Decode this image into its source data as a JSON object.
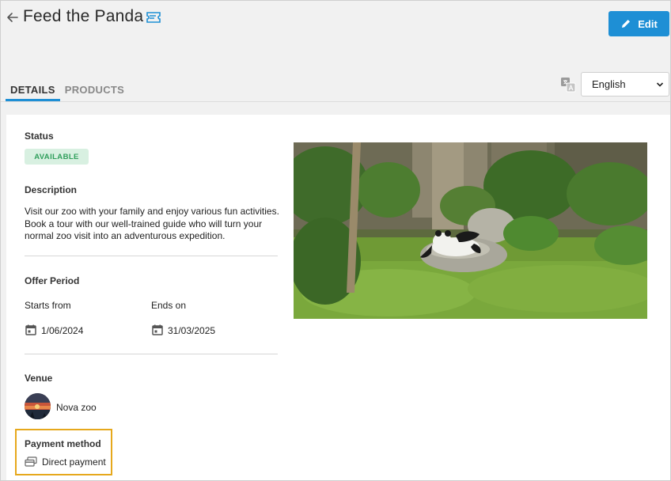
{
  "header": {
    "title": "Feed the Panda",
    "edit_label": "Edit"
  },
  "tabs": [
    {
      "label": "DETAILS",
      "active": true
    },
    {
      "label": "PRODUCTS",
      "active": false
    }
  ],
  "language": {
    "selected": "English"
  },
  "details": {
    "status_label": "Status",
    "status_value": "AVAILABLE",
    "description_label": "Description",
    "description_text": "Visit our zoo with your family and enjoy various fun activities. Book a tour with our well-trained guide who will turn your normal zoo visit into an adventurous expedition.",
    "offer_period_label": "Offer Period",
    "starts_label": "Starts from",
    "starts_value": "1/06/2024",
    "ends_label": "Ends on",
    "ends_value": "31/03/2025",
    "venue_label": "Venue",
    "venue_name": "Nova zoo",
    "payment_label": "Payment method",
    "payment_value": "Direct payment"
  },
  "colors": {
    "accent": "#1e8fd5",
    "status_bg": "#d8f0e1",
    "status_text": "#2f9e5b",
    "highlight_border": "#e6a81c"
  },
  "icons": [
    "back-arrow-icon",
    "ticket-icon",
    "pencil-icon",
    "translate-icon",
    "chevron-down-icon",
    "calendar-icon",
    "payment-card-icon"
  ]
}
